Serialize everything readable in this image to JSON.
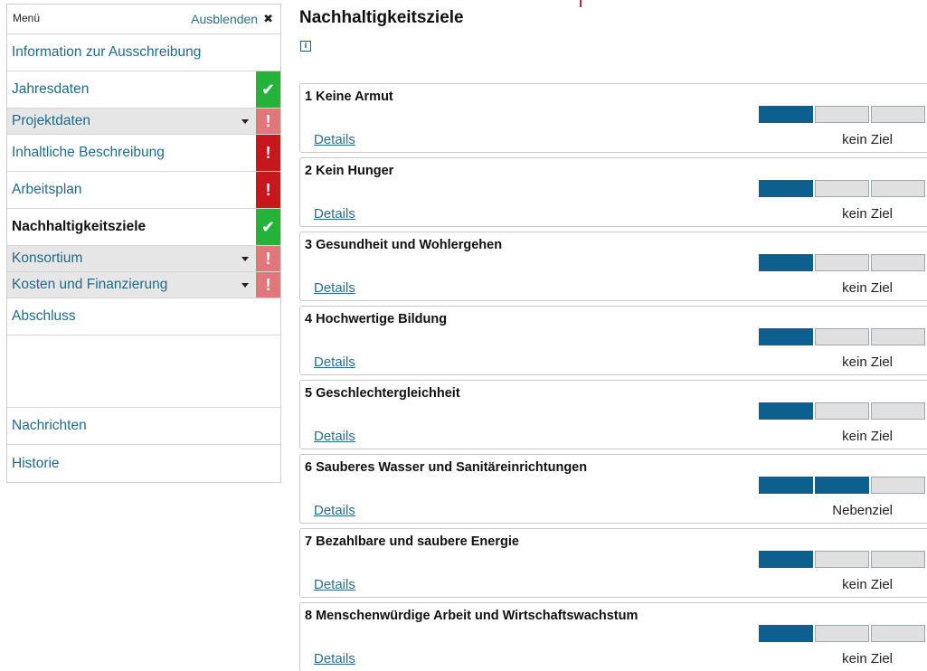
{
  "sidebar": {
    "menu_title": "Menü",
    "hide_label": "Ausblenden",
    "items": [
      {
        "label": "Information zur Ausschreibung"
      },
      {
        "label": "Jahresdaten"
      },
      {
        "label": "Projektdaten"
      },
      {
        "label": "Inhaltliche Beschreibung"
      },
      {
        "label": "Arbeitsplan"
      },
      {
        "label": "Nachhaltigkeitsziele"
      },
      {
        "label": "Konsortium"
      },
      {
        "label": "Kosten und Finanzierung"
      },
      {
        "label": "Abschluss"
      },
      {
        "label": "Nachrichten"
      },
      {
        "label": "Historie"
      }
    ],
    "status_icons": {
      "ok": "✔",
      "err": "!"
    },
    "colors": {
      "ok": "#23b23a",
      "err": "#c8161d",
      "warn": "#e1767b"
    }
  },
  "main": {
    "title": "Nachhaltigkeitsziele",
    "info_icon": "i",
    "details_label": "Details",
    "goals": [
      {
        "title": "1 Keine Armut",
        "level": 1,
        "status": "kein Ziel"
      },
      {
        "title": "2 Kein Hunger",
        "level": 1,
        "status": "kein Ziel"
      },
      {
        "title": "3 Gesundheit und Wohlergehen",
        "level": 1,
        "status": "kein Ziel"
      },
      {
        "title": "4 Hochwertige Bildung",
        "level": 1,
        "status": "kein Ziel"
      },
      {
        "title": "5 Geschlechtergleichheit",
        "level": 1,
        "status": "kein Ziel"
      },
      {
        "title": "6 Sauberes Wasser und Sanitäreinrichtungen",
        "level": 2,
        "status": "Nebenziel"
      },
      {
        "title": "7 Bezahlbare und saubere Energie",
        "level": 1,
        "status": "kein Ziel"
      },
      {
        "title": "8 Menschenwürdige Arbeit und Wirtschaftswachstum",
        "level": 1,
        "status": "kein Ziel"
      }
    ],
    "segment_count": 3,
    "accent_color": "#0d5f8d"
  }
}
